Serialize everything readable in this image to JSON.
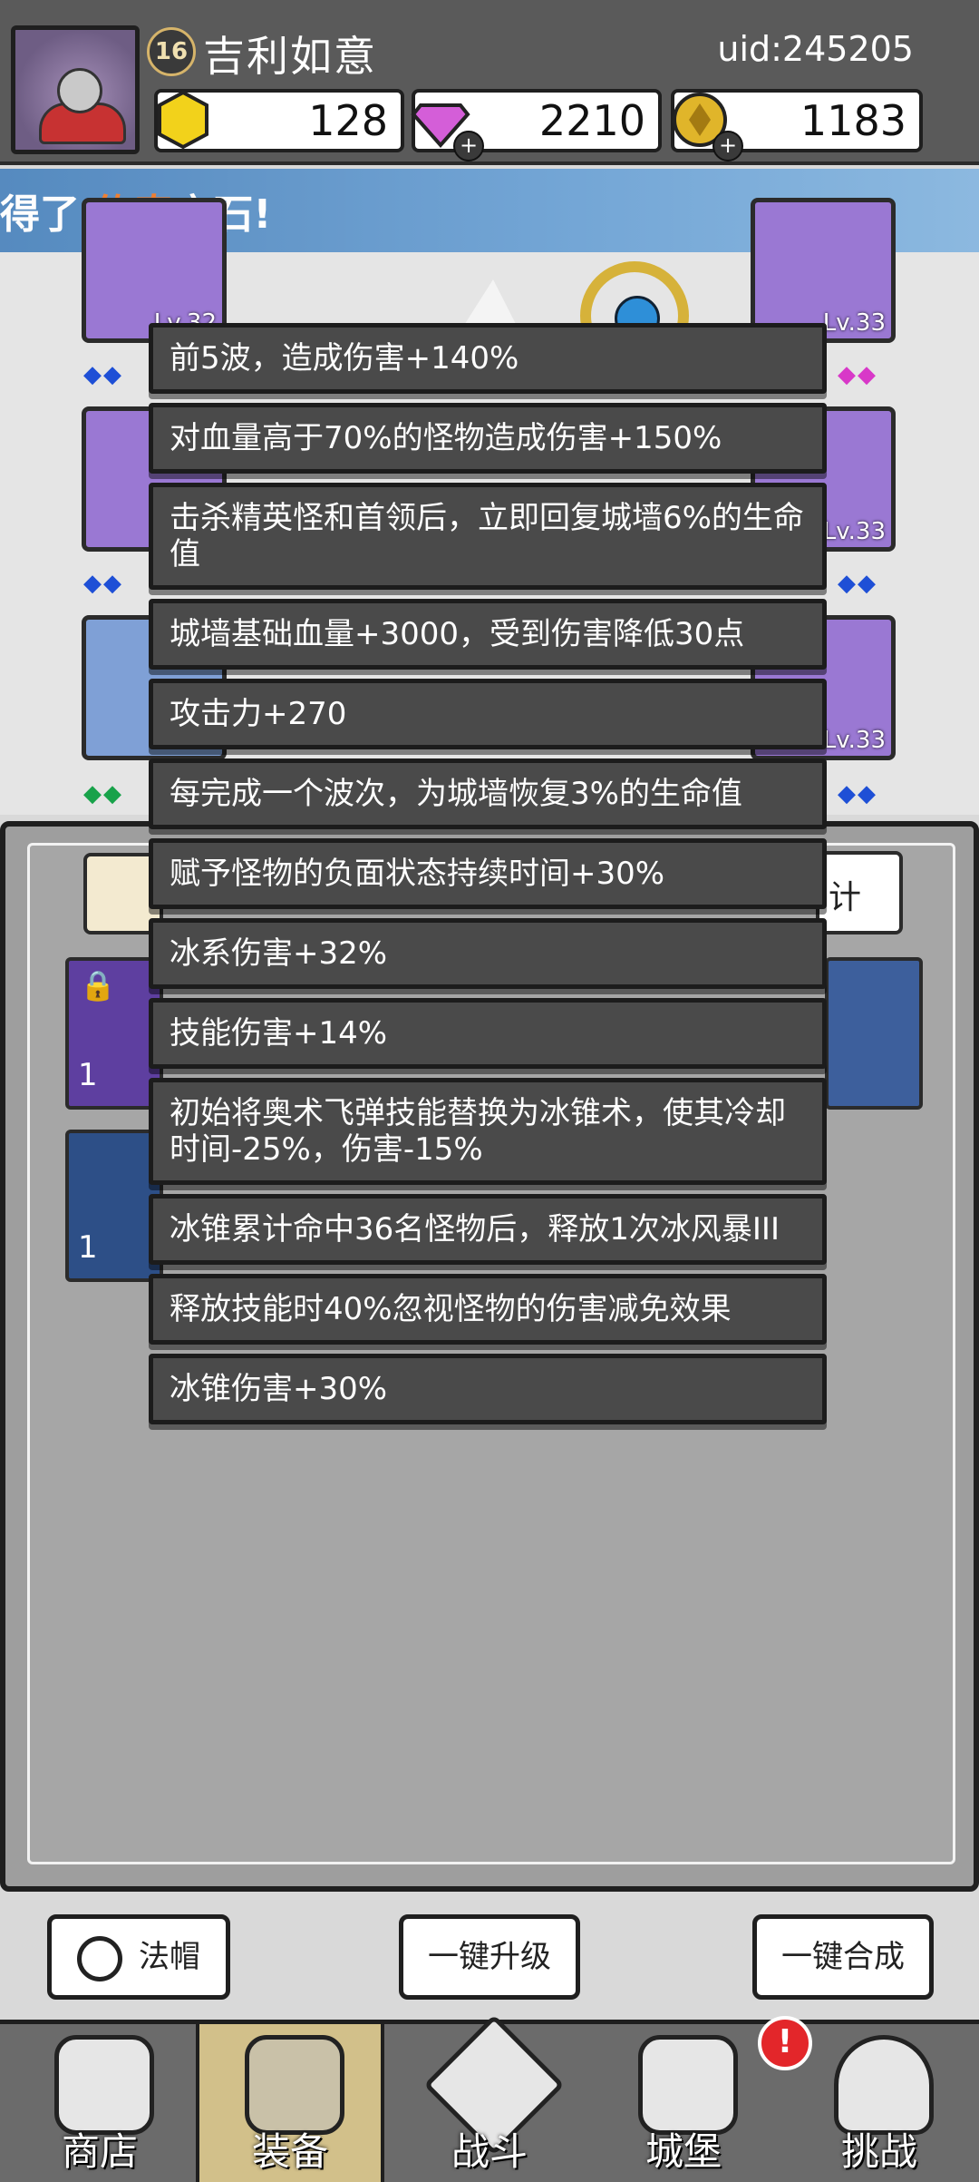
{
  "header": {
    "level": "16",
    "player_name": "吉利如意",
    "uid": "uid:245205",
    "currencies": [
      {
        "name": "gold-bar",
        "value": "128",
        "color": "#f2d21b"
      },
      {
        "name": "diamond",
        "value": "2210",
        "color": "#d45ed8"
      },
      {
        "name": "coin",
        "value": "1183",
        "color": "#e0b52a"
      }
    ]
  },
  "banner": {
    "prefix": "得了",
    "highlight": "传奇",
    "suffix": "宝石!",
    "highlight_color": "#f07b2a"
  },
  "equipment": {
    "slot_levels": [
      "Lv.32",
      "Lv.33",
      "Lv.33",
      "Lv.33"
    ]
  },
  "panel": {
    "right_tab_label": "计",
    "inventory_counts": [
      "1",
      "1"
    ]
  },
  "tooltips": [
    "前5波，造成伤害+140%",
    "对血量高于70%的怪物造成伤害+150%",
    "击杀精英怪和首领后，立即回复城墙6%的生命值",
    "城墙基础血量+3000，受到伤害降低30点",
    "攻击力+270",
    "每完成一个波次，为城墙恢复3%的生命值",
    "赋予怪物的负面状态持续时间+30%",
    "冰系伤害+32%",
    "技能伤害+14%",
    "初始将奥术飞弹技能替换为冰锥术，使其冷却时间-25%，伤害-15%",
    "冰锥累计命中36名怪物后，释放1次冰风暴III",
    "释放技能时40%忽视怪物的伤害减免效果",
    "冰锥伤害+30%"
  ],
  "actions": {
    "filter_label": "法帽",
    "upgrade_all": "一键升级",
    "merge_all": "一键合成"
  },
  "nav": {
    "items": [
      "商店",
      "装备",
      "战斗",
      "城堡",
      "挑战"
    ],
    "active_index": 1,
    "alert_symbol": "!"
  }
}
